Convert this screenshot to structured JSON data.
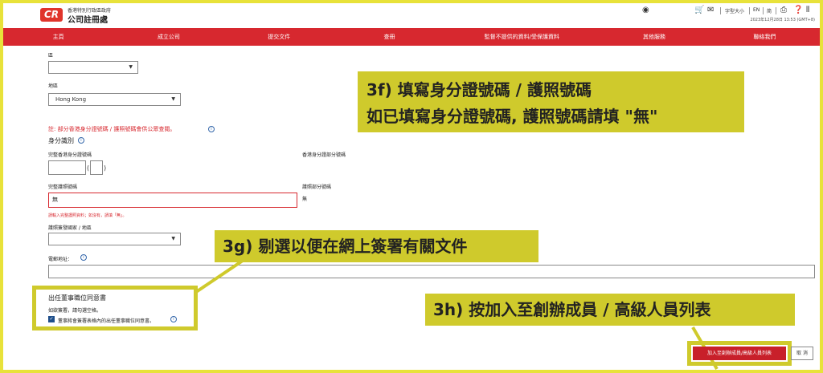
{
  "header": {
    "logo_text": "CR",
    "gov_name": "香港特別行政區政府",
    "registry_name": "公司註冊處",
    "font_size_label": "字型大小",
    "lang_en": "EN",
    "lang_sc": "简",
    "timestamp": "2023年12月28日 13:53 (GMT+8)",
    "icons": [
      "accessibility-icon",
      "cart-icon",
      "mail-icon",
      "print-icon",
      "help-icon",
      "share-icon"
    ]
  },
  "nav": {
    "items": [
      "主頁",
      "成立公司",
      "提交文件",
      "查冊",
      "監督不提供的資料/受保護資料",
      "其他服務",
      "聯絡我們"
    ]
  },
  "form": {
    "district_label": "區",
    "region_label": "地區",
    "region_value": "Hong Kong",
    "note": "註: 部分香港身分證號碼 / 護照號碼會供公眾查閱。",
    "identity_title": "身分識別",
    "hkid_full_label": "完整香港身分證號碼",
    "hkid_partial_label": "香港身分證部分號碼",
    "passport_full_label": "完整護照號碼",
    "passport_full_value": "無",
    "passport_partial_label": "護照部分號碼",
    "passport_partial_value": "無",
    "passport_error": "請輸入完整護照資料；如沒有，請填「無」。",
    "passport_country_label": "護照簽發國家 / 地區",
    "email_label": "電郵地址：",
    "consent_title": "出任董事職位同意書",
    "consent_hint": "如欲簽署，請勾選空格。",
    "consent_checkbox_label": "董事將會簽署表格內的出任董事職位同意書。",
    "checkbox_mark": "✓"
  },
  "callouts": {
    "c3f_line1": "3f) 填寫身分證號碼 / 護照號碼",
    "c3f_line2": "如已填寫身分證號碼, 護照號碼請填 \"無\"",
    "c3g": "3g) 剔選以便在網上簽署有關文件",
    "c3h": "3h) 按加入至創辦成員 / 高級人員列表"
  },
  "buttons": {
    "add_label": "加入至創辦成員/高級人員列表",
    "cancel_label": "取 消"
  },
  "colors": {
    "brand_red": "#d7282f",
    "callout_yellow": "#cfca2c",
    "checkbox_blue": "#1e4e8a"
  }
}
